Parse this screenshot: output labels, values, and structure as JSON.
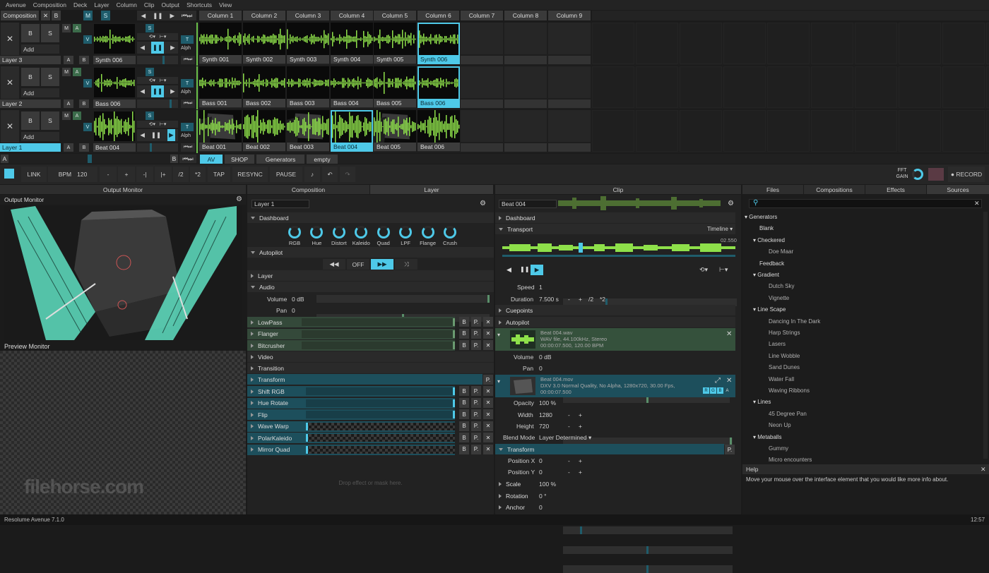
{
  "menu": [
    "Avenue",
    "Composition",
    "Deck",
    "Layer",
    "Column",
    "Clip",
    "Output",
    "Shortcuts",
    "View"
  ],
  "comp": {
    "label": "Composition",
    "x": "✕",
    "b": "B",
    "m": "M",
    "s": "S"
  },
  "columns": [
    "Column 1",
    "Column 2",
    "Column 3",
    "Column 4",
    "Column 5",
    "Column 6",
    "Column 7",
    "Column 8",
    "Column 9"
  ],
  "layers": [
    {
      "name": "Layer 3",
      "clip": "Synth 006",
      "clips": [
        "Synth 001",
        "Synth 002",
        "Synth 003",
        "Synth 004",
        "Synth 005",
        "Synth 006"
      ]
    },
    {
      "name": "Layer 2",
      "clip": "Bass 006",
      "clips": [
        "Bass 001",
        "Bass 002",
        "Bass 003",
        "Bass 004",
        "Bass 005",
        "Bass 006"
      ]
    },
    {
      "name": "Layer 1",
      "clip": "Beat 004",
      "clips": [
        "Beat 001",
        "Beat 002",
        "Beat 003",
        "Beat 004",
        "Beat 005",
        "Beat 006"
      ]
    }
  ],
  "layerctl": {
    "close": "✕",
    "b": "B",
    "s": "S",
    "add": "Add",
    "m": "M",
    "a": "A",
    "v": "V",
    "bb": "B",
    "t": "T",
    "alph": "Alph",
    "s2": "S"
  },
  "decks": [
    "AV",
    "SHOP",
    "Generators",
    "empty"
  ],
  "deckbar": {
    "a": "A",
    "b": "B"
  },
  "toolbar": {
    "link": "LINK",
    "bpm_label": "BPM",
    "bpm": "120",
    "minus": "-",
    "plus": "+",
    "nudge_l": "-|",
    "nudge_r": "|+",
    "half": "/2",
    "double": "*2",
    "tap": "TAP",
    "resync": "RESYNC",
    "pause": "PAUSE",
    "fft": "FFT",
    "gain": "GAIN",
    "record": "● RECORD"
  },
  "output": {
    "header": "Output Monitor",
    "title": "Output Monitor",
    "preview": "Preview Monitor",
    "watermark": "filehorse.com"
  },
  "mid_tabs": {
    "comp": "Composition",
    "layer": "Layer"
  },
  "layer_panel": {
    "name": "Layer 1",
    "dashboard": "Dashboard",
    "knobs": [
      "RGB",
      "Hue",
      "Distort",
      "Kaleido",
      "Quad",
      "LPF",
      "Flange",
      "Crush"
    ],
    "autopilot": "Autopilot",
    "off": "OFF",
    "layer": "Layer",
    "audio": "Audio",
    "volume_label": "Volume",
    "volume": "0 dB",
    "pan_label": "Pan",
    "pan": "0",
    "effects_audio": [
      "LowPass",
      "Flanger",
      "Bitcrusher"
    ],
    "video": "Video",
    "transition": "Transition",
    "transform": "Transform",
    "effects_video": [
      "Shift RGB",
      "Hue Rotate",
      "Flip",
      "Wave Warp",
      "PolarKaleido",
      "Mirror Quad"
    ],
    "drop": "Drop effect or mask here.",
    "bp": "B",
    "pp": "P.",
    "xx": "✕"
  },
  "clip_panel": {
    "header": "Clip",
    "name": "Beat 004",
    "dashboard": "Dashboard",
    "transport": "Transport",
    "timeline": "Timeline",
    "time": "02.550",
    "speed_label": "Speed",
    "speed": "1",
    "duration_label": "Duration",
    "duration": "7.500 s",
    "dminus": "-",
    "dplus": "+",
    "dhalf": "/2",
    "ddouble": "*2",
    "cuepoints": "Cuepoints",
    "autopilot": "Autopilot",
    "audio_file": "Beat 004.wav",
    "audio_info1": "WAV file, 44.100kHz, Stereo",
    "audio_info2": "00:00:07.500, 120.00 BPM",
    "volume_label": "Volume",
    "volume": "0 dB",
    "pan_label": "Pan",
    "pan": "0",
    "video_file": "Beat 004.mov",
    "video_info1": "DXV 3.0 Normal Quality, No Alpha, 1280x720, 30.00 Fps,",
    "video_info2": "00:00:07.500",
    "rgba": [
      "R",
      "G",
      "B",
      "A"
    ],
    "opacity_label": "Opacity",
    "opacity": "100 %",
    "width_label": "Width",
    "width": "1280",
    "height_label": "Height",
    "height": "720",
    "blend_label": "Blend Mode",
    "blend": "Layer Determined",
    "transform": "Transform",
    "pp": "P.",
    "posx_label": "Position X",
    "posx": "0",
    "posy_label": "Position Y",
    "posy": "0",
    "scale_label": "Scale",
    "scale": "100 %",
    "rotation_label": "Rotation",
    "rotation": "0 °",
    "anchor_label": "Anchor",
    "anchor": "0",
    "minus": "-",
    "plus": "+",
    "close": "✕",
    "expand": "⤢"
  },
  "right_tabs": [
    "Files",
    "Compositions",
    "Effects",
    "Sources"
  ],
  "sources": [
    {
      "t": "g",
      "l": "Generators"
    },
    {
      "t": "i",
      "l": "Blank"
    },
    {
      "t": "f",
      "l": "Checkered"
    },
    {
      "t": "s",
      "l": "Doe Maar"
    },
    {
      "t": "i",
      "l": "Feedback"
    },
    {
      "t": "f",
      "l": "Gradient"
    },
    {
      "t": "s",
      "l": "Dutch Sky"
    },
    {
      "t": "s",
      "l": "Vignette"
    },
    {
      "t": "f",
      "l": "Line Scape"
    },
    {
      "t": "s",
      "l": "Dancing In The Dark"
    },
    {
      "t": "s",
      "l": "Harp Strings"
    },
    {
      "t": "s",
      "l": "Lasers"
    },
    {
      "t": "s",
      "l": "Line Wobble"
    },
    {
      "t": "s",
      "l": "Sand Dunes"
    },
    {
      "t": "s",
      "l": "Water Fall"
    },
    {
      "t": "s",
      "l": "Waving Ribbons"
    },
    {
      "t": "f",
      "l": "Lines"
    },
    {
      "t": "s",
      "l": "45 Degree Pan"
    },
    {
      "t": "s",
      "l": "Neon Up"
    },
    {
      "t": "f",
      "l": "Metaballs"
    },
    {
      "t": "s",
      "l": "Gummy"
    },
    {
      "t": "s",
      "l": "Micro encounters"
    }
  ],
  "help": {
    "title": "Help",
    "text": "Move your mouse over the interface element that you would like more info about.",
    "close": "✕"
  },
  "status": {
    "app": "Resolume Avenue 7.1.0",
    "time": "12:57"
  },
  "colors": {
    "accent": "#4ec9e8",
    "wave": "#8ee04a"
  }
}
